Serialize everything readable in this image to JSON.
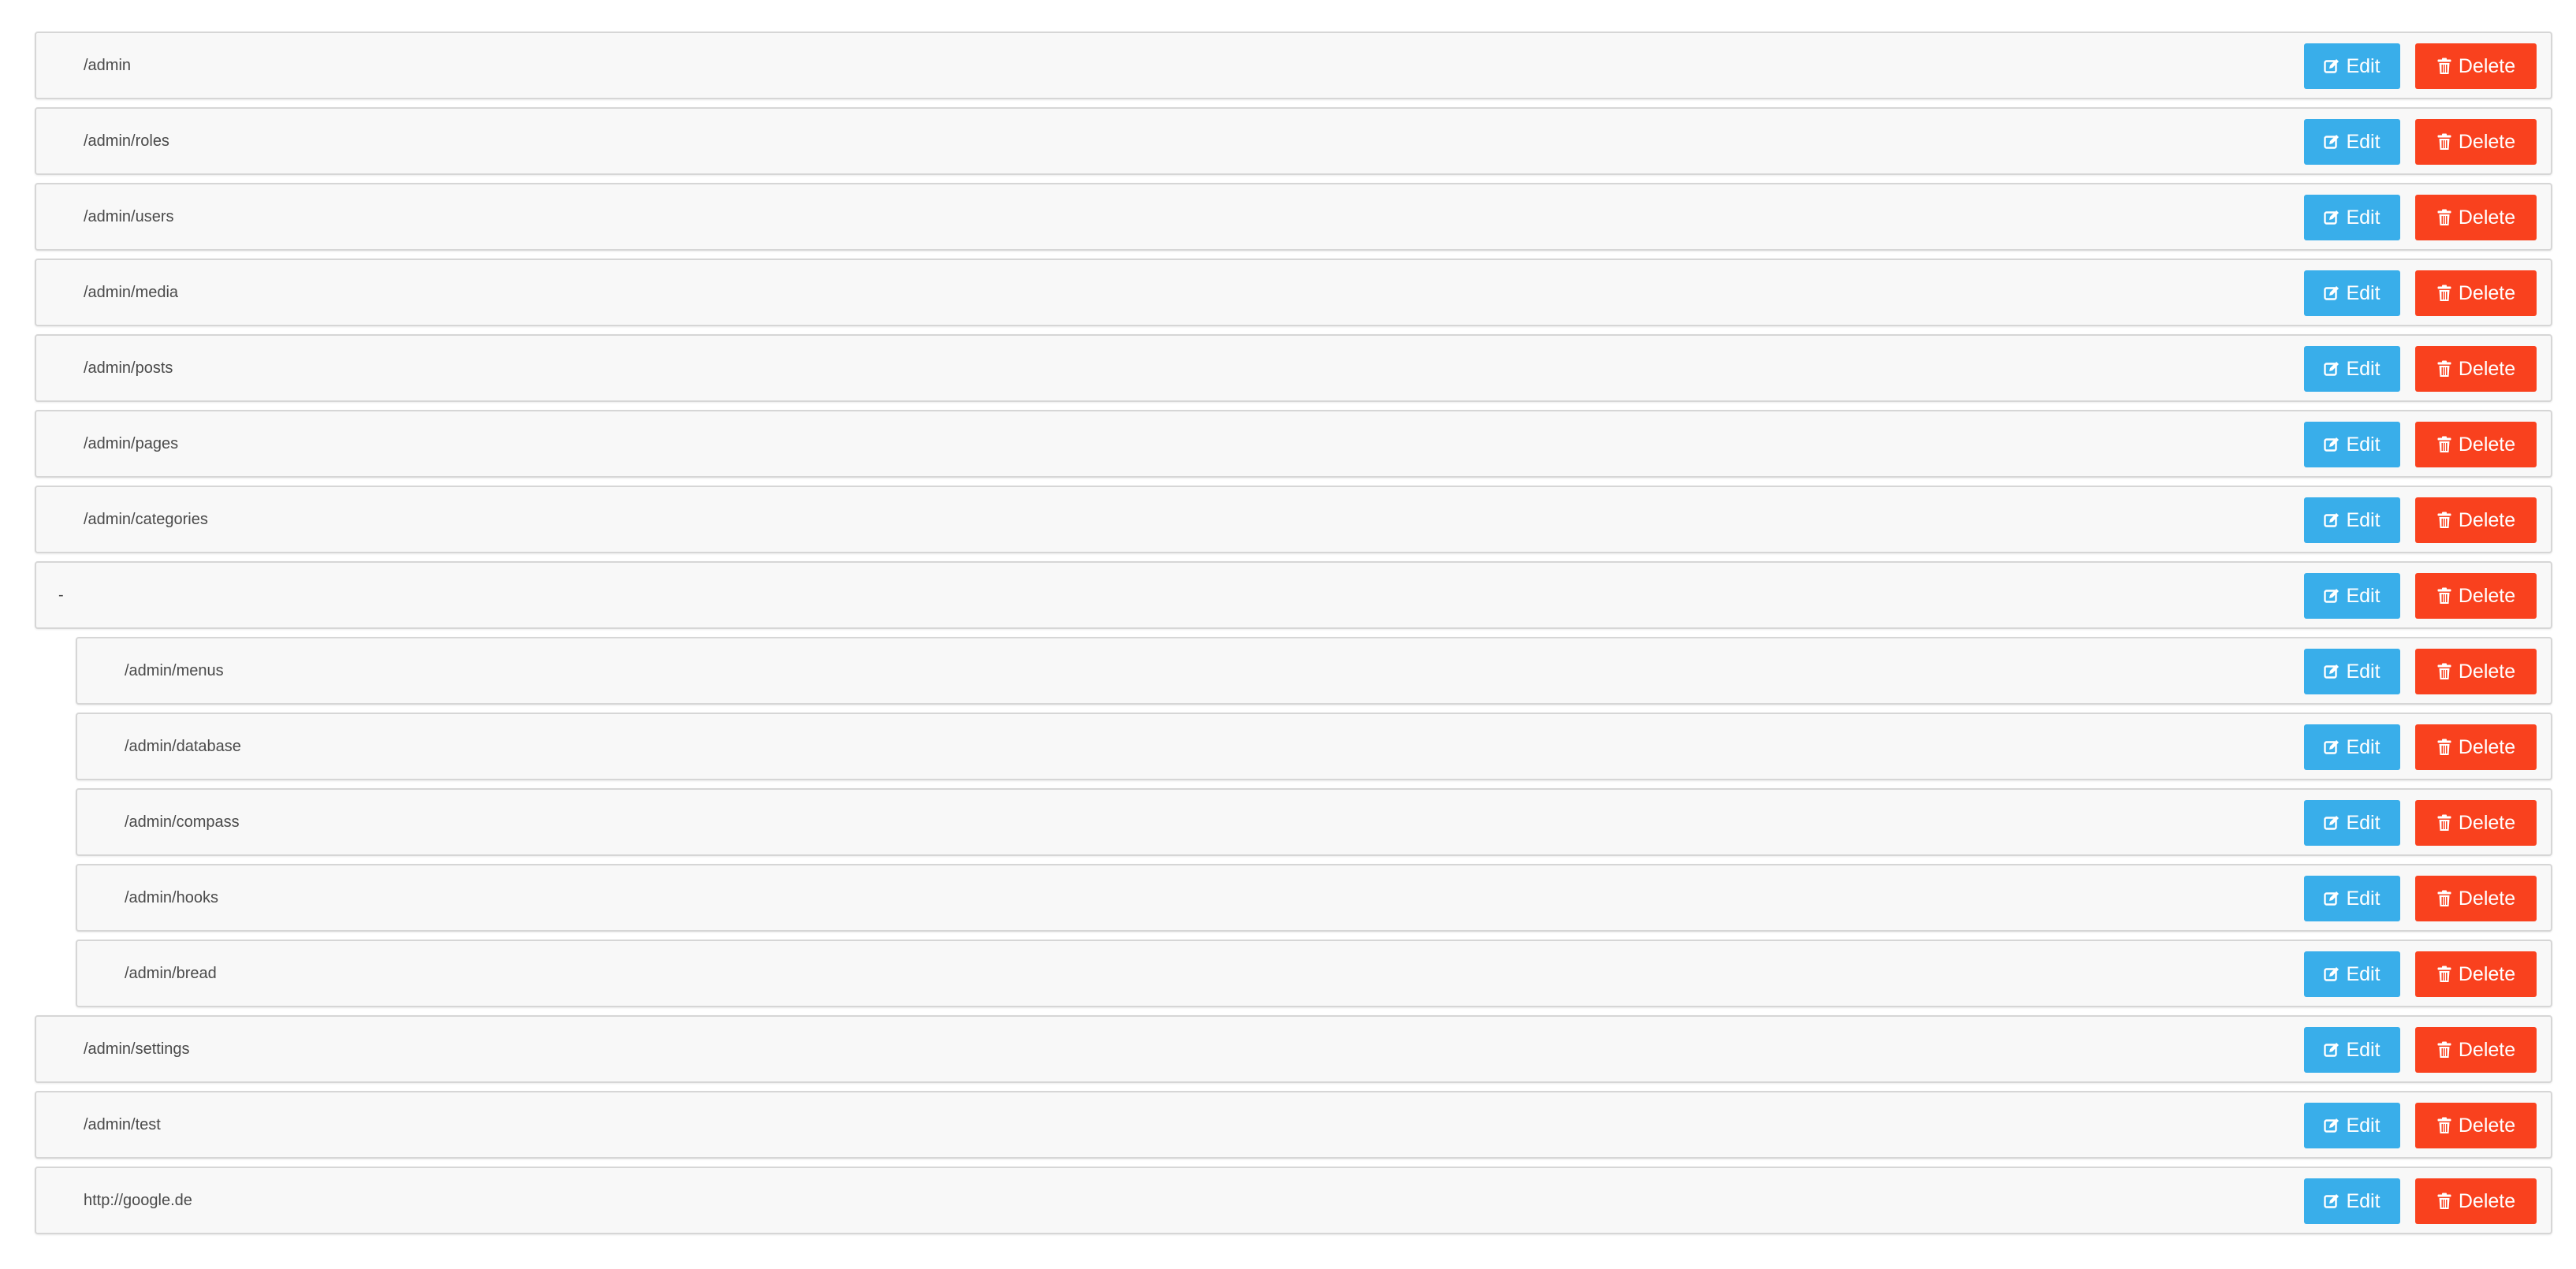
{
  "buttons": {
    "edit_label": "Edit",
    "delete_label": "Delete",
    "edit_icon": "edit-icon",
    "delete_icon": "trash-icon"
  },
  "colors": {
    "edit": "#39aeea",
    "delete": "#f9411e",
    "row_background": "#f8f8f8",
    "row_border": "#d6d6d6",
    "text": "#4a4a4a"
  },
  "menu_items": [
    {
      "label": "/admin",
      "level": 0
    },
    {
      "label": "/admin/roles",
      "level": 0
    },
    {
      "label": "/admin/users",
      "level": 0
    },
    {
      "label": "/admin/media",
      "level": 0
    },
    {
      "label": "/admin/posts",
      "level": 0
    },
    {
      "label": "/admin/pages",
      "level": 0
    },
    {
      "label": "/admin/categories",
      "level": 0
    },
    {
      "label": "-",
      "level": 0
    },
    {
      "label": "/admin/menus",
      "level": 1
    },
    {
      "label": "/admin/database",
      "level": 1
    },
    {
      "label": "/admin/compass",
      "level": 1
    },
    {
      "label": "/admin/hooks",
      "level": 1
    },
    {
      "label": "/admin/bread",
      "level": 1
    },
    {
      "label": "/admin/settings",
      "level": 0
    },
    {
      "label": "/admin/test",
      "level": 0
    },
    {
      "label": "http://google.de",
      "level": 0
    }
  ]
}
